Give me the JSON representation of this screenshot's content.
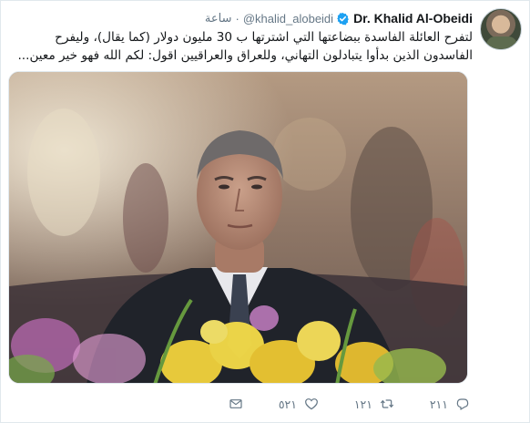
{
  "tweet": {
    "display_name": "Dr. Khalid Al-Obeidi",
    "handle": "@khalid_alobeidi",
    "separator": "·",
    "time": "ساعة",
    "text": "لتفرح العائلة الفاسدة ببضاعتها التي اشترتها ب 30 مليون دولار (كما يقال)، وليفرح الفاسدون الذين بدأوا يتبادلون التهاني، وللعراق والعراقيين اقول: لكم الله فهو خير معين..."
  },
  "actions": {
    "reply_count": "٢١١",
    "retweet_count": "١٢١",
    "like_count": "٥٢١"
  },
  "icons": {
    "verified": "verified-badge-icon",
    "reply": "reply-icon",
    "retweet": "retweet-icon",
    "like": "heart-icon",
    "dm": "envelope-icon"
  },
  "colors": {
    "verified_blue": "#1da1f2",
    "meta_gray": "#657786"
  }
}
